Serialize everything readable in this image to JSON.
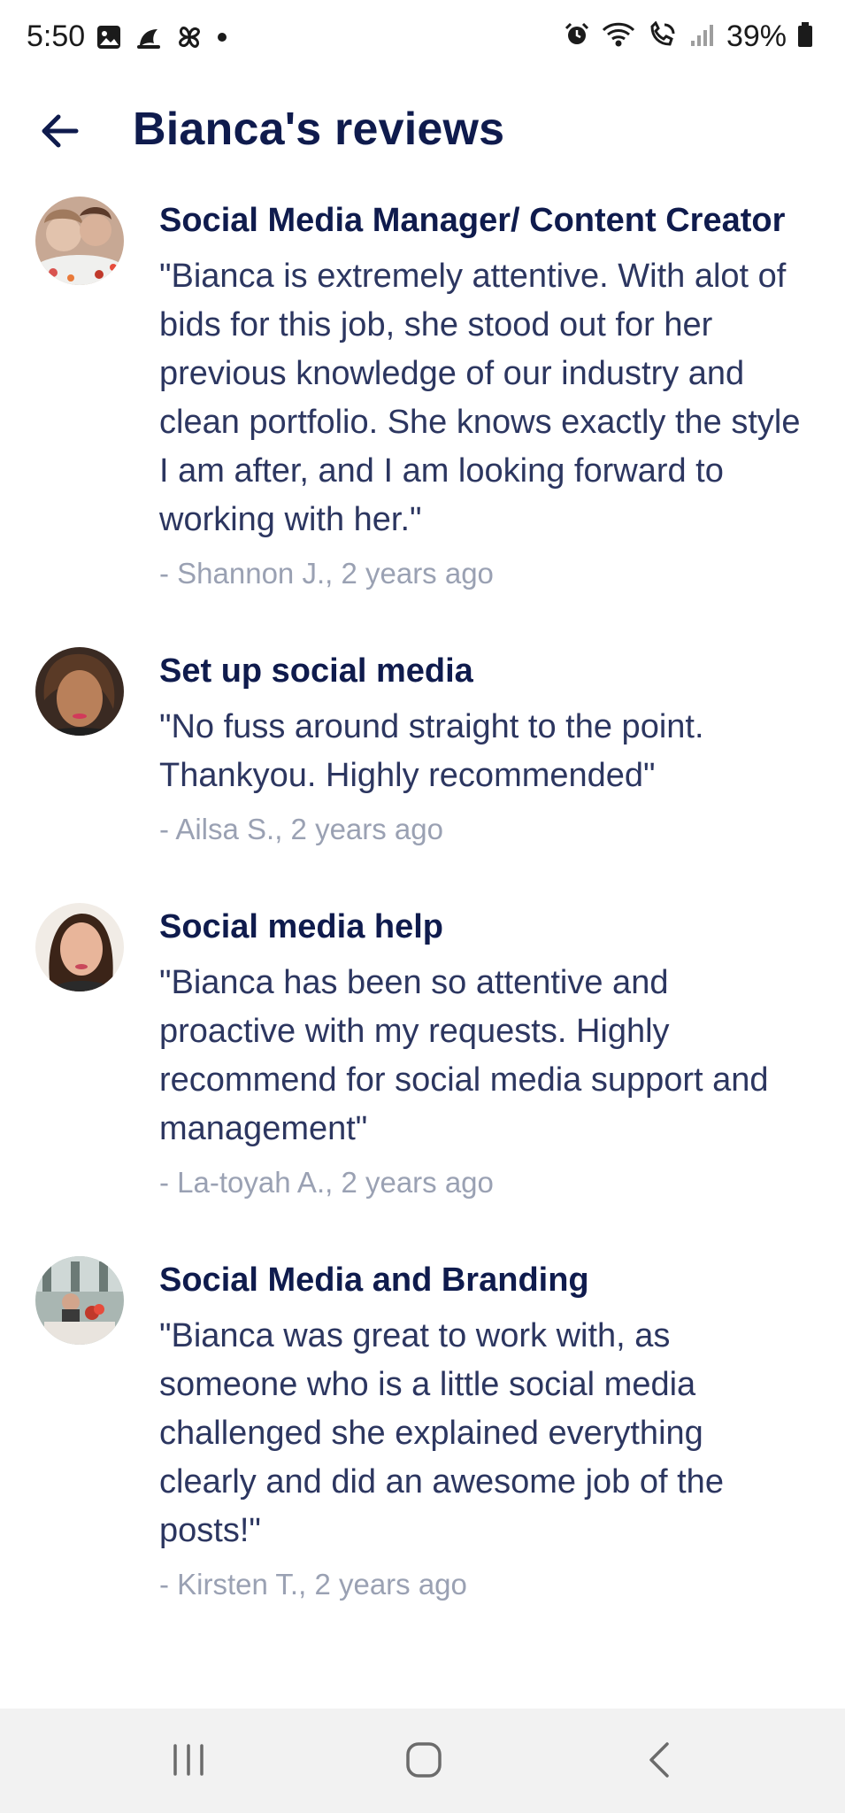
{
  "status_bar": {
    "time": "5:50",
    "battery": "39%",
    "icons_left": [
      "image-icon",
      "moon-leaf-icon",
      "pinwheel-icon",
      "dot-icon"
    ],
    "icons_right": [
      "alarm-icon",
      "wifi-icon",
      "wifi-calling-icon",
      "signal-icon",
      "battery-icon"
    ]
  },
  "header": {
    "title": "Bianca's reviews",
    "back_icon": "arrow-left-icon"
  },
  "reviews": [
    {
      "title": "Social Media Manager/ Content Creator",
      "text": "\"Bianca is extremely attentive. With alot of bids for this job, she stood out for her previous knowledge of our industry and clean portfolio. She knows exactly the style I am after, and I am looking forward to working with her.\"",
      "meta": "- Shannon J., 2 years ago"
    },
    {
      "title": "Set up social media",
      "text": "\"No fuss around straight to the point. Thankyou. Highly recommended\"",
      "meta": "- Ailsa S., 2 years ago"
    },
    {
      "title": "Social media help",
      "text": "\"Bianca has been so attentive and proactive with my requests. Highly recommend for social media support and management\"",
      "meta": "- La-toyah A., 2 years ago"
    },
    {
      "title": "Social Media and Branding",
      "text": "\"Bianca was great to work with, as someone who is a little social media challenged she explained everything clearly and did an awesome job of the posts!\"",
      "meta": "- Kirsten T., 2 years ago"
    }
  ],
  "nav_bar": {
    "recents_icon": "recents-icon",
    "home_icon": "home-icon",
    "back_icon": "chevron-left-icon"
  },
  "colors": {
    "title": "#0f1b4d",
    "body_text": "#2c3660",
    "meta_text": "#9aa1b3",
    "nav_background": "#f2f2f2"
  }
}
